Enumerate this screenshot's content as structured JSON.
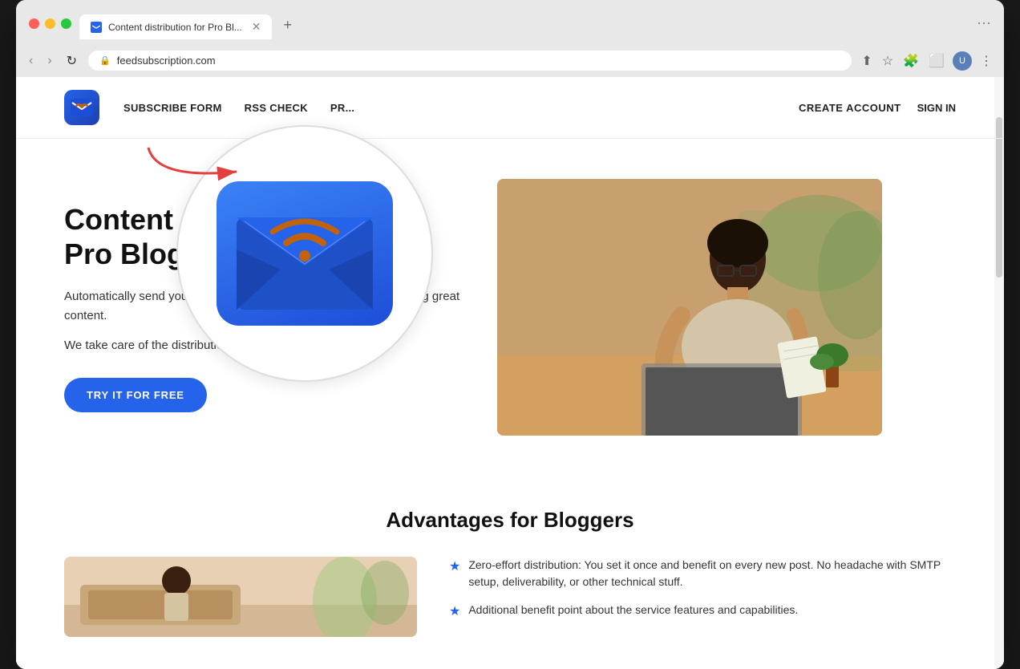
{
  "browser": {
    "tab_title": "Content distribution for Pro Bl...",
    "address": "feedsubscription.com",
    "new_tab_label": "+",
    "scrollbar_visible": true
  },
  "nav": {
    "subscribe_form_label": "SUBSCRIBE FORM",
    "rss_check_label": "RSS CHECK",
    "pricing_label": "PR...",
    "create_account_label": "CREATE ACCOUNT",
    "sign_in_label": "SIGN IN"
  },
  "hero": {
    "title_line1": "Content dist",
    "title_line2": "Pro Blogger",
    "description": "Automatically send your late subscribers' inboxes. Focus on creating great content.",
    "tagline": "We take care of the distribution.",
    "cta_button": "TRY IT FOR FREE"
  },
  "advantages": {
    "section_title": "Advantages for Bloggers",
    "items": [
      {
        "text": "Zero-effort distribution: You set it once and benefit on every new post. No headache with SMTP setup, deliverability, or other technical stuff."
      },
      {
        "text": "Additional benefit point about the service features and capabilities."
      }
    ]
  }
}
